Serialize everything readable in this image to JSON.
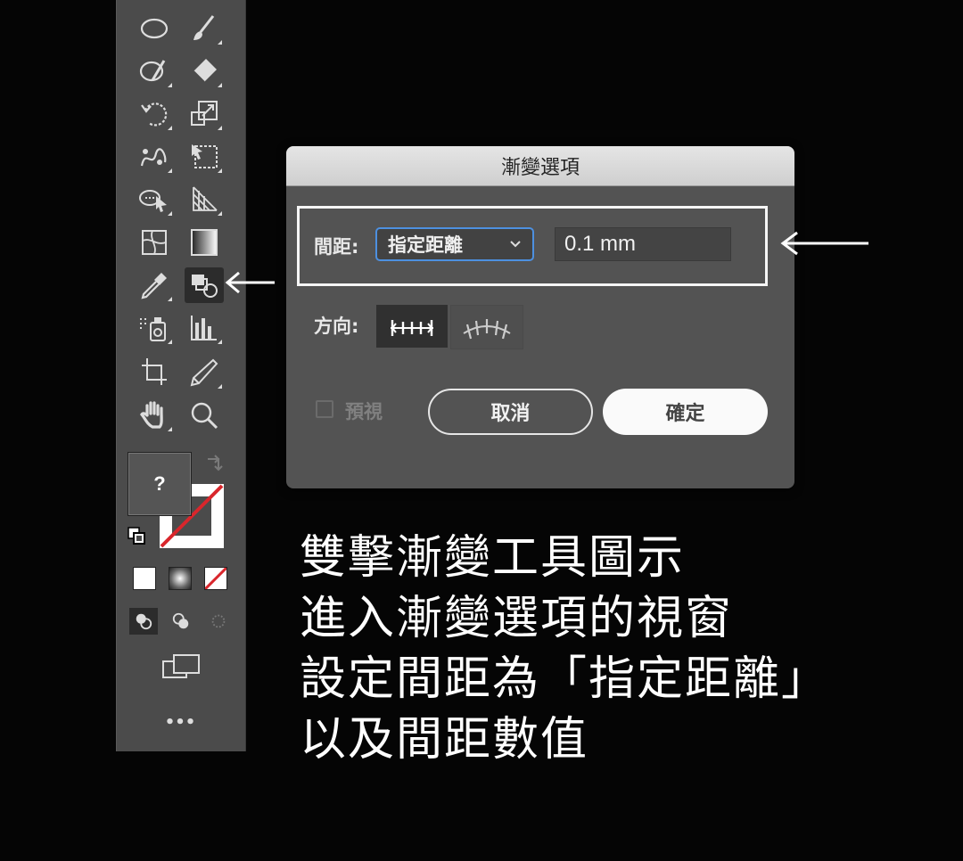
{
  "dialog": {
    "title": "漸變選項",
    "spacing_label": "間距:",
    "spacing_option": "指定距離",
    "spacing_value": "0.1 mm",
    "orientation_label": "方向:",
    "preview_label": "預視",
    "cancel_label": "取消",
    "ok_label": "確定"
  },
  "toolbar": {
    "fill_label": "?",
    "more_label": "•••",
    "tools": [
      "ellipse-tool",
      "paintbrush-tool",
      "shaper-tool",
      "eraser-tool",
      "rotate-tool",
      "scale-tool",
      "puppet-warp-tool",
      "free-transform-tool",
      "shape-builder-tool",
      "perspective-grid-tool",
      "mesh-tool",
      "gradient-tool",
      "eyedropper-tool",
      "blend-tool",
      "symbol-sprayer-tool",
      "column-graph-tool",
      "artboard-tool",
      "slice-tool",
      "hand-tool",
      "zoom-tool"
    ],
    "active_tool": "blend-tool"
  },
  "caption": {
    "lines": [
      "雙擊漸變工具圖示",
      "進入漸變選項的視窗",
      "設定間距為「指定距離」",
      "以及間距數值"
    ]
  },
  "colors": {
    "accent_blue": "#4d90e0",
    "none_red": "#d9262c",
    "dialog_bg": "#535353",
    "toolbar_bg": "#4b4b4b"
  }
}
